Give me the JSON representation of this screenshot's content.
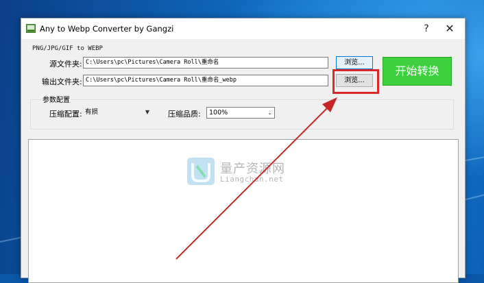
{
  "window": {
    "title": "Any to Webp Converter by Gangzi",
    "help_label": "?",
    "close_label": "✕"
  },
  "format_label": "PNG/JPG/GIF to WEBP",
  "source": {
    "label": "源文件夹:",
    "value": "C:\\Users\\pc\\Pictures\\Camera Roll\\重命名",
    "browse_label": "浏览..."
  },
  "output": {
    "label": "输出文件夹:",
    "value": "C:\\Users\\pc\\Pictures\\Camera Roll\\重命名_webp",
    "browse_label": "浏览..."
  },
  "start_button_label": "开始转换",
  "params": {
    "group_title": "参数配置",
    "compression_label": "压缩配置:",
    "compression_value": "有损",
    "quality_label": "压缩品质:",
    "quality_value": "100%"
  },
  "watermark": {
    "brand": "量产资源网",
    "site": "Liangchan.net"
  },
  "colors": {
    "start_button": "#3fd03f",
    "highlight_box": "#d8282a",
    "annotation_arrow": "#c62828"
  },
  "icons": {
    "app": "app-icon",
    "combo_arrow": "chevron-down-icon"
  }
}
